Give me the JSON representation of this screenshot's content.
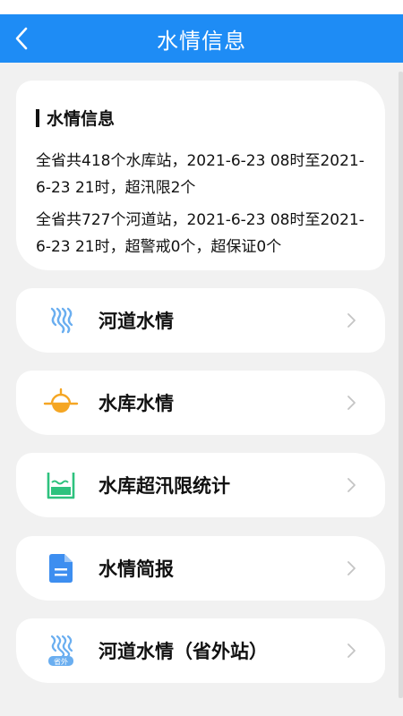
{
  "header": {
    "title": "水情信息",
    "back_icon": "back-arrow-icon",
    "color": "#1e8cf5"
  },
  "info": {
    "heading": "水情信息",
    "line1": "全省共418个水库站，2021-6-23 08时至2021-6-23 21时，超汛限2个",
    "line2": "全省共727个河道站，2021-6-23 08时至2021-6-23 21时，超警戒0个，超保证0个"
  },
  "menu": [
    {
      "label": "河道水情",
      "icon": "river-waves-icon"
    },
    {
      "label": "水库水情",
      "icon": "reservoir-gauge-icon"
    },
    {
      "label": "水库超汛限统计",
      "icon": "reservoir-flood-stats-icon"
    },
    {
      "label": "水情简报",
      "icon": "document-icon"
    },
    {
      "label": "河道水情（省外站）",
      "icon": "out-of-province-river-icon",
      "badge": "省外"
    }
  ],
  "colors": {
    "river_blue": "#6aaef0",
    "reservoir_orange": "#f5a623",
    "stats_green": "#2ec27e",
    "doc_blue": "#3d8ef0"
  }
}
